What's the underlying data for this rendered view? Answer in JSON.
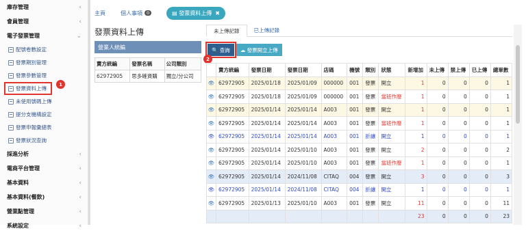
{
  "sidebar": {
    "items": [
      {
        "label": "庫存管理"
      },
      {
        "label": "會員管理"
      },
      {
        "label": "電子發票管理"
      }
    ],
    "sub_items": [
      {
        "label": "配號卷數設定"
      },
      {
        "label": "發票期別管理"
      },
      {
        "label": "發票參數管理"
      },
      {
        "label": "發票資料上傳"
      },
      {
        "label": "未使用號碼上傳"
      },
      {
        "label": "提分支機構設定"
      },
      {
        "label": "發票申報彙總表"
      },
      {
        "label": "發票狀況查詢"
      }
    ],
    "items_after": [
      {
        "label": "採進分析"
      },
      {
        "label": "電商平台管理"
      },
      {
        "label": "基本資料"
      },
      {
        "label": "基本資料(餐飲)"
      },
      {
        "label": "營業點管理"
      },
      {
        "label": "系統設定"
      }
    ],
    "badge_1": "1"
  },
  "tabs": {
    "home": "主頁",
    "personal": "個人事項",
    "personal_count": "0",
    "active": "發票資料上傳"
  },
  "page_title": "發票資料上傳",
  "panel": {
    "head": "營業人統編",
    "columns": [
      "賣方統編",
      "發票名稱",
      "公司類別"
    ],
    "rows": [
      [
        "62972905",
        "思多確資購",
        "獨立/分公司"
      ]
    ]
  },
  "right": {
    "tab_pending": "未上傳記錄",
    "tab_uploaded": "已上傳記錄",
    "query_button": "查詢",
    "upload_button": "發票開立上傳",
    "badge_2": "2",
    "columns": [
      "賣方統編",
      "發票日期",
      "發票日期",
      "店碼",
      "機號",
      "類別",
      "狀態",
      "新增加",
      "未上傳",
      "禁上傳",
      "已上傳",
      "總單數"
    ],
    "rows": [
      {
        "style": "row-warm",
        "cells": [
          "62972905",
          "2025/01/18",
          "2025/01/09",
          "000000",
          "001",
          "發票",
          "開立",
          "1",
          "0",
          "0",
          "0",
          "1"
        ]
      },
      {
        "style": "",
        "cells": [
          "62972905",
          "2025/01/18",
          "2025/01/09",
          "000000",
          "001",
          "發票",
          "當班作廢",
          "1",
          "0",
          "0",
          "0",
          "1"
        ]
      },
      {
        "style": "row-warm",
        "cells": [
          "62972905",
          "2025/01/14",
          "2025/01/14",
          "A003",
          "001",
          "發票",
          "開立",
          "1",
          "0",
          "0",
          "0",
          "1"
        ]
      },
      {
        "style": "",
        "cells": [
          "62972905",
          "2025/01/14",
          "2025/01/14",
          "A003",
          "001",
          "發票",
          "當班作廢",
          "1",
          "0",
          "0",
          "0",
          "1"
        ]
      },
      {
        "style": "blue-text",
        "cells": [
          "62972905",
          "2025/01/14",
          "2025/01/14",
          "A003",
          "001",
          "折讓",
          "開立",
          "1",
          "0",
          "0",
          "0",
          "1"
        ]
      },
      {
        "style": "",
        "cells": [
          "62972905",
          "2025/01/14",
          "2025/01/10",
          "A003",
          "001",
          "發票",
          "開立",
          "2",
          "0",
          "0",
          "0",
          "2"
        ]
      },
      {
        "style": "",
        "cells": [
          "62972905",
          "2025/01/14",
          "2025/01/10",
          "A003",
          "001",
          "發票",
          "當班作廢",
          "1",
          "0",
          "0",
          "0",
          "1"
        ]
      },
      {
        "style": "row-blue",
        "cells": [
          "62972905",
          "2025/01/14",
          "2024/11/08",
          "CITAQ",
          "004",
          "發票",
          "開立",
          "3",
          "0",
          "0",
          "0",
          "3"
        ]
      },
      {
        "style": "blue-text",
        "cells": [
          "62972905",
          "2025/01/14",
          "2024/11/08",
          "CITAQ",
          "004",
          "折讓",
          "開立",
          "1",
          "0",
          "0",
          "0",
          "1"
        ]
      },
      {
        "style": "",
        "cells": [
          "62972905",
          "2025/01/13",
          "2025/01/10",
          "A003",
          "001",
          "發票",
          "開立",
          "11",
          "0",
          "0",
          "0",
          "11"
        ]
      }
    ],
    "totals": [
      "23",
      "0",
      "0",
      "0",
      "23"
    ]
  }
}
